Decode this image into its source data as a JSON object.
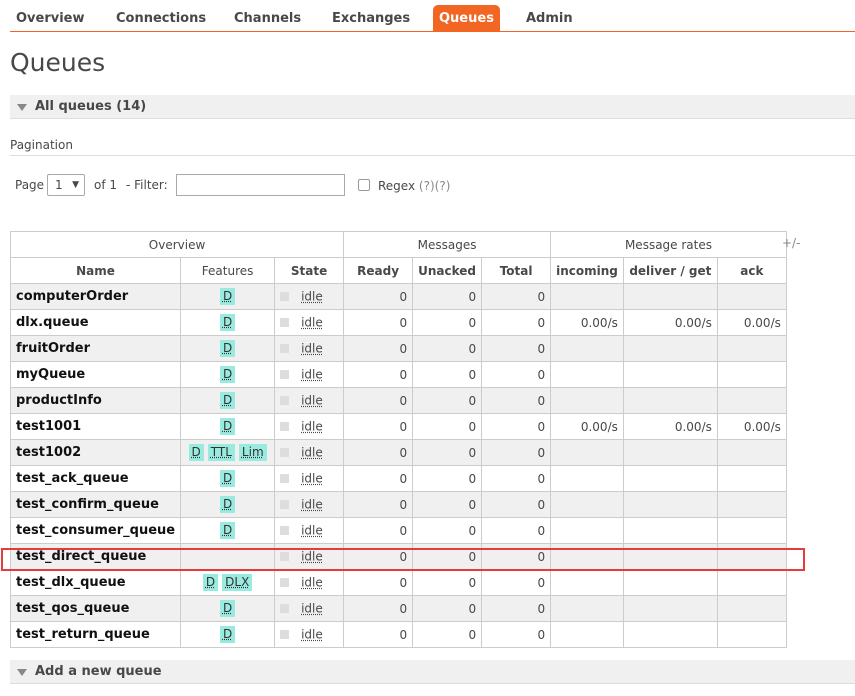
{
  "nav": {
    "tabs": [
      {
        "label": "Overview",
        "active": false
      },
      {
        "label": "Connections",
        "active": false
      },
      {
        "label": "Channels",
        "active": false
      },
      {
        "label": "Exchanges",
        "active": false
      },
      {
        "label": "Queues",
        "active": true
      },
      {
        "label": "Admin",
        "active": false
      }
    ],
    "accent_color": "#f26522"
  },
  "page_title": "Queues",
  "all_queues": {
    "title": "All queues (14)"
  },
  "pagination": {
    "label": "Pagination",
    "page_label": "Page",
    "page_value": "1",
    "of_text": "of 1",
    "filter_label": "- Filter:",
    "filter_value": "",
    "regex_label": "Regex",
    "regex_help": "(?)(?)"
  },
  "table": {
    "group_headers": [
      "Overview",
      "Messages",
      "Message rates"
    ],
    "columns": [
      "Name",
      "Features",
      "State",
      "Ready",
      "Unacked",
      "Total",
      "incoming",
      "deliver / get",
      "ack"
    ],
    "plus_minus": "+/-",
    "rows": [
      {
        "name": "computerOrder",
        "features": [
          "D"
        ],
        "state": "idle",
        "ready": "0",
        "unacked": "0",
        "total": "0",
        "incoming": "",
        "deliver": "",
        "ack": ""
      },
      {
        "name": "dlx.queue",
        "features": [
          "D"
        ],
        "state": "idle",
        "ready": "0",
        "unacked": "0",
        "total": "0",
        "incoming": "0.00/s",
        "deliver": "0.00/s",
        "ack": "0.00/s"
      },
      {
        "name": "fruitOrder",
        "features": [
          "D"
        ],
        "state": "idle",
        "ready": "0",
        "unacked": "0",
        "total": "0",
        "incoming": "",
        "deliver": "",
        "ack": ""
      },
      {
        "name": "myQueue",
        "features": [
          "D"
        ],
        "state": "idle",
        "ready": "0",
        "unacked": "0",
        "total": "0",
        "incoming": "",
        "deliver": "",
        "ack": ""
      },
      {
        "name": "productInfo",
        "features": [
          "D"
        ],
        "state": "idle",
        "ready": "0",
        "unacked": "0",
        "total": "0",
        "incoming": "",
        "deliver": "",
        "ack": ""
      },
      {
        "name": "test1001",
        "features": [
          "D"
        ],
        "state": "idle",
        "ready": "0",
        "unacked": "0",
        "total": "0",
        "incoming": "0.00/s",
        "deliver": "0.00/s",
        "ack": "0.00/s"
      },
      {
        "name": "test1002",
        "features": [
          "D",
          "TTL",
          "Lim"
        ],
        "state": "idle",
        "ready": "0",
        "unacked": "0",
        "total": "0",
        "incoming": "",
        "deliver": "",
        "ack": ""
      },
      {
        "name": "test_ack_queue",
        "features": [
          "D"
        ],
        "state": "idle",
        "ready": "0",
        "unacked": "0",
        "total": "0",
        "incoming": "",
        "deliver": "",
        "ack": ""
      },
      {
        "name": "test_confirm_queue",
        "features": [
          "D"
        ],
        "state": "idle",
        "ready": "0",
        "unacked": "0",
        "total": "0",
        "incoming": "",
        "deliver": "",
        "ack": ""
      },
      {
        "name": "test_consumer_queue",
        "features": [
          "D"
        ],
        "state": "idle",
        "ready": "0",
        "unacked": "0",
        "total": "0",
        "incoming": "",
        "deliver": "",
        "ack": ""
      },
      {
        "name": "test_direct_queue",
        "features": [],
        "state": "idle",
        "ready": "0",
        "unacked": "0",
        "total": "0",
        "incoming": "",
        "deliver": "",
        "ack": ""
      },
      {
        "name": "test_dlx_queue",
        "features": [
          "D",
          "DLX"
        ],
        "state": "idle",
        "ready": "0",
        "unacked": "0",
        "total": "0",
        "incoming": "",
        "deliver": "",
        "ack": ""
      },
      {
        "name": "test_qos_queue",
        "features": [
          "D"
        ],
        "state": "idle",
        "ready": "0",
        "unacked": "0",
        "total": "0",
        "incoming": "",
        "deliver": "",
        "ack": ""
      },
      {
        "name": "test_return_queue",
        "features": [
          "D"
        ],
        "state": "idle",
        "ready": "0",
        "unacked": "0",
        "total": "0",
        "incoming": "",
        "deliver": "",
        "ack": ""
      }
    ]
  },
  "add_queue": {
    "title": "Add a new queue"
  },
  "highlight_color": "#e43b3b"
}
